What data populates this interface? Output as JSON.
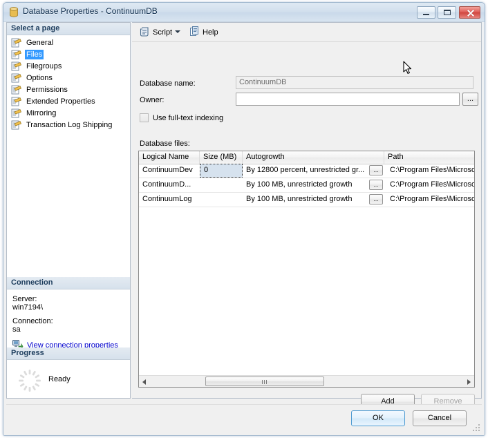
{
  "window": {
    "title": "Database Properties - ContinuumDB",
    "icon": "database-icon",
    "minimize_label": "Minimize",
    "maximize_label": "Maximize",
    "close_label": "Close"
  },
  "sidebar": {
    "select_page_header": "Select a page",
    "pages": [
      {
        "label": "General",
        "selected": false
      },
      {
        "label": "Files",
        "selected": true
      },
      {
        "label": "Filegroups",
        "selected": false
      },
      {
        "label": "Options",
        "selected": false
      },
      {
        "label": "Permissions",
        "selected": false
      },
      {
        "label": "Extended Properties",
        "selected": false
      },
      {
        "label": "Mirroring",
        "selected": false
      },
      {
        "label": "Transaction Log Shipping",
        "selected": false
      }
    ],
    "connection": {
      "header": "Connection",
      "server_label": "Server:",
      "server_value": "win7194\\",
      "connection_label": "Connection:",
      "connection_value": "sa",
      "link_label": "View connection properties",
      "link_color": "#0000cd"
    },
    "progress": {
      "header": "Progress",
      "status": "Ready"
    }
  },
  "toolbar": {
    "script_label": "Script",
    "help_label": "Help"
  },
  "form": {
    "database_name_label": "Database name:",
    "database_name_value": "ContinuumDB",
    "owner_label": "Owner:",
    "owner_value": "",
    "owner_browse_label": "...",
    "fulltext_label": "Use full-text indexing",
    "fulltext_checked": false,
    "database_files_label": "Database files:"
  },
  "grid": {
    "columns": [
      "Logical Name",
      "Size (MB)",
      "Autogrowth",
      "Path"
    ],
    "ellipsis_label": "...",
    "rows": [
      {
        "logical_name": "ContinuumDev",
        "size_mb": "0",
        "autogrowth": "By 12800 percent, unrestricted gr...",
        "path": "C:\\Program Files\\Microsoft",
        "selected_cell": "size_mb"
      },
      {
        "logical_name": "ContinuumD...",
        "size_mb": "",
        "autogrowth": "By 100 MB, unrestricted growth",
        "path": "C:\\Program Files\\Microsoft",
        "selected_cell": ""
      },
      {
        "logical_name": "ContinuumLog",
        "size_mb": "",
        "autogrowth": "By 100 MB, unrestricted growth",
        "path": "C:\\Program Files\\Microsoft",
        "selected_cell": ""
      }
    ]
  },
  "actions": {
    "add_label": "Add",
    "remove_label": "Remove",
    "remove_enabled": false,
    "ok_label": "OK",
    "cancel_label": "Cancel"
  },
  "colors": {
    "selection_blue": "#3399ff",
    "cell_select_fill": "#d6e2ee",
    "title_text": "#0b2a4a",
    "close_red": "#d0463f",
    "ok_focus_border": "#4f9bd1"
  }
}
